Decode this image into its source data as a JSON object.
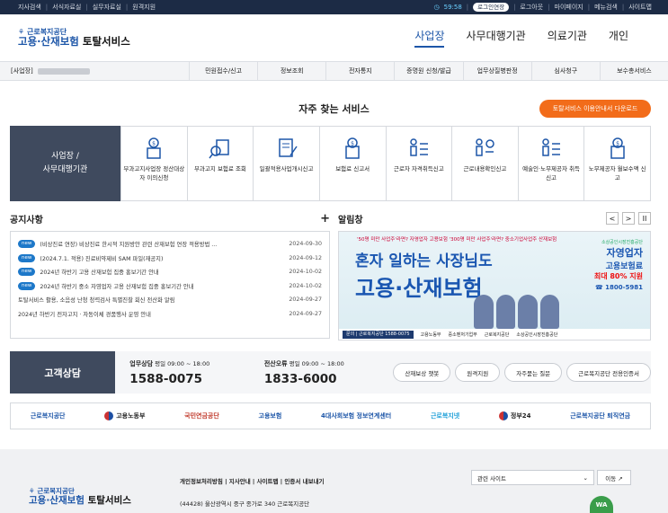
{
  "topbar": {
    "left": [
      "지사검색",
      "서식자료실",
      "실무자료실",
      "원격지원"
    ],
    "timer": "59:58",
    "extend": "로그인연장",
    "right": [
      "로그아웃",
      "마이페이지",
      "메뉴검색",
      "사이트맵"
    ]
  },
  "header": {
    "org": "근로복지공단",
    "service_a": "고용·산재보험",
    "service_b": "토탈서비스",
    "nav": [
      "사업장",
      "사무대행기관",
      "의료기관",
      "개인"
    ]
  },
  "subnav": {
    "biz_label": "[사업장]",
    "items": [
      "민원접수/신고",
      "정보조회",
      "전자통지",
      "증명원 신청/발급",
      "업무상질병판정",
      "심사청구",
      "보수총서비스"
    ]
  },
  "frequent": {
    "title": "자주 찾는 서비스",
    "download": "토탈서비스 이용안내서 다운로드",
    "category": [
      "사업장 /",
      "사무대행기관"
    ],
    "tiles": [
      "부과고지사업장 정산대상자 이의신청",
      "부과고지 보험료 조회",
      "일괄적용사업개시신고",
      "보험료 신고서",
      "근로자 자격취득신고",
      "근로내용확인신고",
      "예술인·노무제공자 취득신고",
      "노무제공자 월보수액 신고"
    ]
  },
  "notice": {
    "title": "공지사항",
    "plus": "+",
    "badge": "new",
    "items": [
      {
        "new": true,
        "title": "(비상진료 연장) 비상진료 한시적 지원방안 관련 산재보험 연장 적용방법 ...",
        "date": "2024-09-30"
      },
      {
        "new": true,
        "title": "(2024.7.1. 적용) 진료비약제비 SAM 파일(재공지)",
        "date": "2024-09-12"
      },
      {
        "new": true,
        "title": "2024년 하반기 고용 산재보험 집중 홍보기간 안내",
        "date": "2024-10-02"
      },
      {
        "new": true,
        "title": "2024년 하반기 중소 자영업자 고용 산재보험 집중 홍보기간 안내",
        "date": "2024-10-02"
      },
      {
        "new": false,
        "title": "토탈서비스 활용, 소음성 난청 청력검사 특별진찰 회신 전산화 알림",
        "date": "2024-09-27"
      },
      {
        "new": false,
        "title": "2024년 하반기 전자고지 · 자동이체 경품행사 운영 안내",
        "date": "2024-09-27"
      }
    ]
  },
  "alert": {
    "title": "알림창",
    "prev": "<",
    "next": ">",
    "pause": "II",
    "banner": {
      "top": "'50명 미만 사업주'라면? 자영업자 고용보험 '300명 미만 사업주'라면? 중소기업사업주 산재보험",
      "h1": "혼자 일하는 사장님도",
      "h2": "고용·산재보험",
      "p0": "소상공인시장진흥공단",
      "p1": "자영업자",
      "p2": "고용보험료",
      "p3": "최대 80% 지원",
      "p4": "1800-5981",
      "foot_q": "문의",
      "foot_org": "근로복지공단 1588-0075",
      "foot_logos": [
        "고용노동부",
        "중소벤처기업부",
        "근로복지공단",
        "소상공인시장진흥공단"
      ]
    }
  },
  "counsel": {
    "title": "고객상담",
    "a_label": "업무상담",
    "a_hours": "평일 09:00 ~ 18:00",
    "a_num": "1588-0075",
    "b_label": "전산오류",
    "b_hours": "평일 09:00 ~ 18:00",
    "b_num": "1833-6000",
    "buttons": [
      "산재보상 챗봇",
      "원격지원",
      "자주묻는 질문",
      "근로복지공단 전용인증서"
    ]
  },
  "partners": [
    "근로복지공단",
    "고용노동부",
    "국민연금공단",
    "고용보험",
    "4대사회보험 정보연계센터",
    "근로복지넷",
    "정부24",
    "근로복지공단 퇴직연금"
  ],
  "footer": {
    "org": "근로복지공단",
    "service_a": "고용·산재보험",
    "service_b": "토탈서비스",
    "links": [
      "개인정보처리방침",
      "지사안내",
      "사이트맵",
      "인증서 내보내기"
    ],
    "address": "(44428) 울산광역시 중구 종가로 340 근로복지공단",
    "site_select": "관련 사이트",
    "go": "이동 ↗",
    "wa": "WA"
  },
  "colors": {
    "primary": "#1d56a8",
    "dark": "#1c2b45",
    "orange": "#f26c1a",
    "badge": "#1d78c9",
    "slate": "#3f4a5e"
  }
}
